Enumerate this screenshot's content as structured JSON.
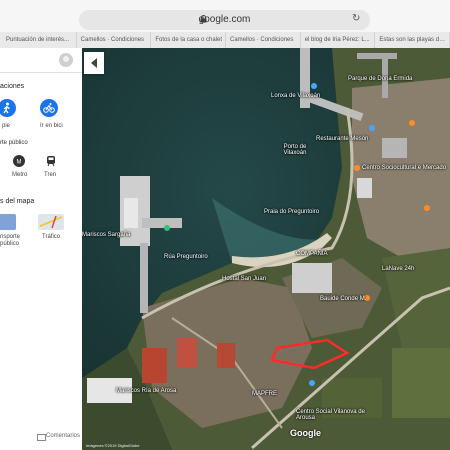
{
  "browser": {
    "url": "google.com",
    "tabs": [
      "Puntuación de interés...",
      "Camellos · Condiciones",
      "Fotos de la casa o chalet",
      "Camellos · Condiciones",
      "el blog de Iria Pérez: L...",
      "Estas son las playas de..."
    ]
  },
  "panel": {
    "directions_title": "aciones",
    "modes": [
      {
        "label": "pie",
        "icon": "walk-icon"
      },
      {
        "label": "Ir en bici",
        "icon": "bike-icon"
      }
    ],
    "transit_title": "rte público",
    "transit": [
      {
        "label": "Metro",
        "icon": "metro-icon"
      },
      {
        "label": "Tren",
        "icon": "train-icon"
      }
    ],
    "layers_title": "s del mapa",
    "layers": [
      {
        "label": "nsporte\npúblico"
      },
      {
        "label": "Tráfico"
      }
    ],
    "comments": "Comentarios"
  },
  "map": {
    "labels": [
      "Lonxa de Vilaxoán",
      "Parque de Dona Ermida",
      "Porto de Vilaxoán",
      "Restaurante Mesón",
      "Centro Sociocultural e Mercado",
      "Praia do Preguntoiro",
      "Mariscos Sargaña",
      "Rúa Preguntoiro",
      "Hostal San Juan",
      "Bauide Conde M.",
      "LaNave 24h",
      "Mariscos Ría de Arosa",
      "MAPFRE",
      "Centro Social Vilanova de Arousa",
      "COMPAÑÍA"
    ],
    "logo": "Google",
    "attribution": "Imágenes ©2019 DigitalGlobe"
  },
  "colors": {
    "sea": "#1d3f3f",
    "land": "#4a5a35",
    "accent": "#1a73e8",
    "highlight": "#ff2a2a"
  }
}
